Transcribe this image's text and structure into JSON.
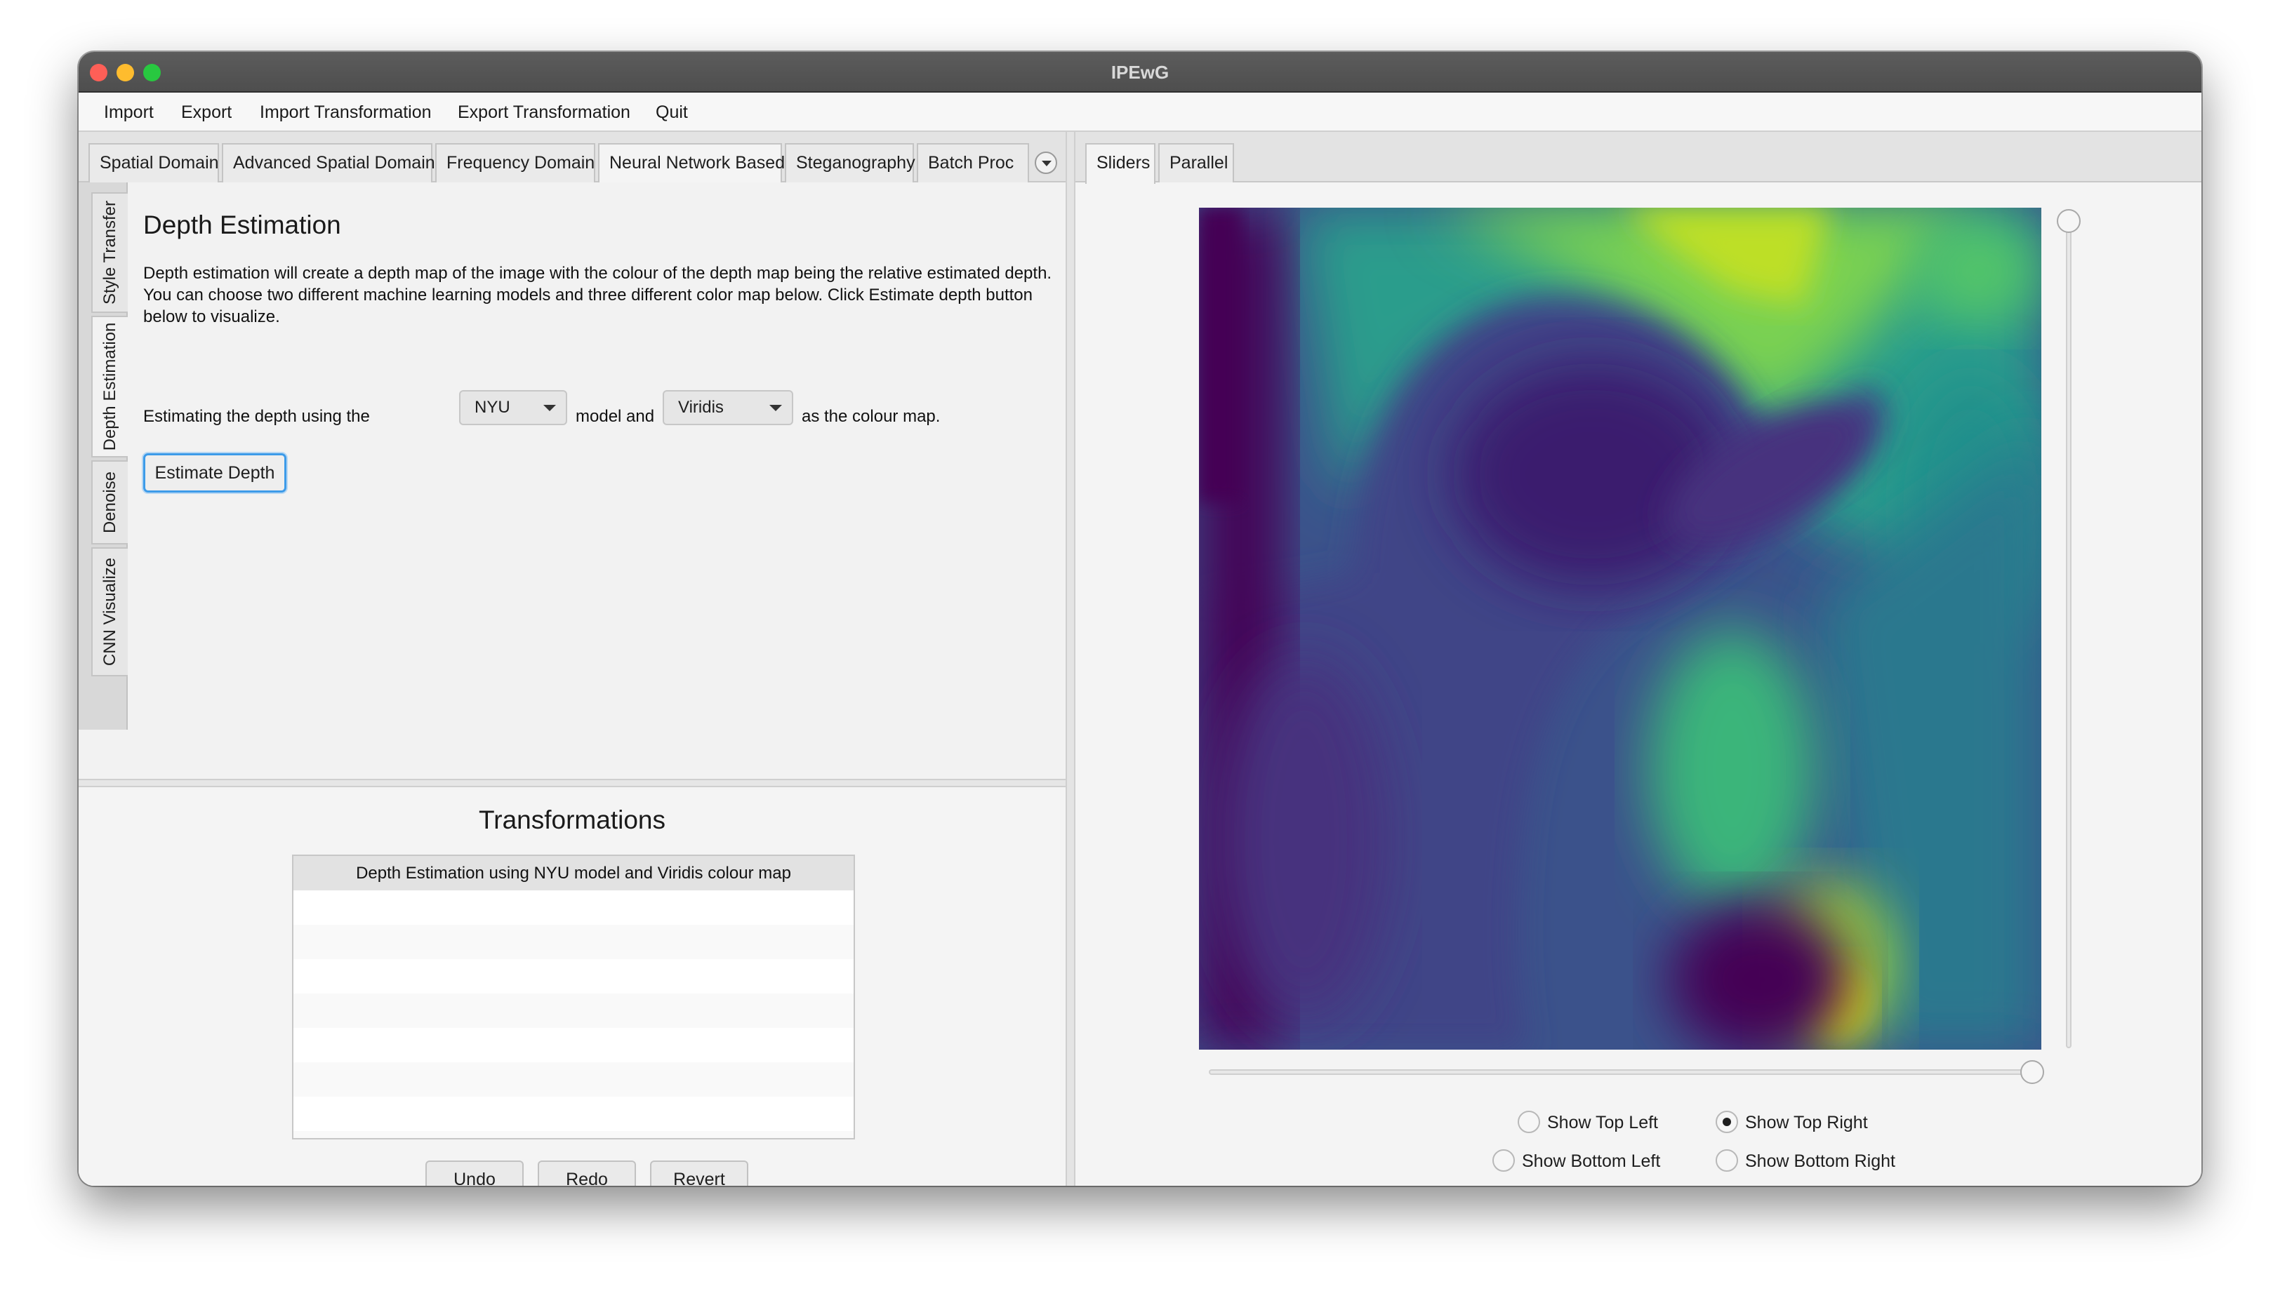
{
  "window": {
    "title": "IPEwG"
  },
  "menu": [
    "Import",
    "Export",
    "Import Transformation",
    "Export Transformation",
    "Quit"
  ],
  "left_tabs": [
    "Spatial Domain",
    "Advanced Spatial Domain",
    "Frequency Domain",
    "Neural Network Based",
    "Steganography",
    "Batch Proc"
  ],
  "left_tabs_active": "Neural Network Based",
  "side_tabs": [
    "Style Transfer",
    "Depth Estimation",
    "Denoise",
    "CNN Visualize"
  ],
  "side_tabs_active": "Depth Estimation",
  "depth_panel": {
    "title": "Depth Estimation",
    "description": "Depth estimation will create a depth map of the image with the colour of the depth map being the relative estimated depth. You can choose two different machine learning models and three different color map below. Click Estimate depth button below to visualize.",
    "prefix": "Estimating the depth using the",
    "model_value": "NYU",
    "middle": "model and",
    "colormap_value": "Viridis",
    "suffix": "as the colour map.",
    "button": "Estimate Depth"
  },
  "transformations": {
    "title": "Transformations",
    "items": [
      "Depth Estimation using NYU model and Viridis colour map"
    ],
    "buttons": {
      "undo": "Undo",
      "redo": "Redo",
      "revert": "Revert"
    }
  },
  "right_tabs": [
    "Sliders",
    "Parallel"
  ],
  "right_tabs_active": "Sliders",
  "image": {
    "colormap": "viridis"
  },
  "sliders": {
    "vertical_level": 1.0,
    "horizontal_level": 1.0
  },
  "radio_options": {
    "top_left": "Show Top Left",
    "top_right": "Show Top Right",
    "bottom_left": "Show Bottom Left",
    "bottom_right": "Show Bottom Right",
    "selected": "top_right"
  }
}
